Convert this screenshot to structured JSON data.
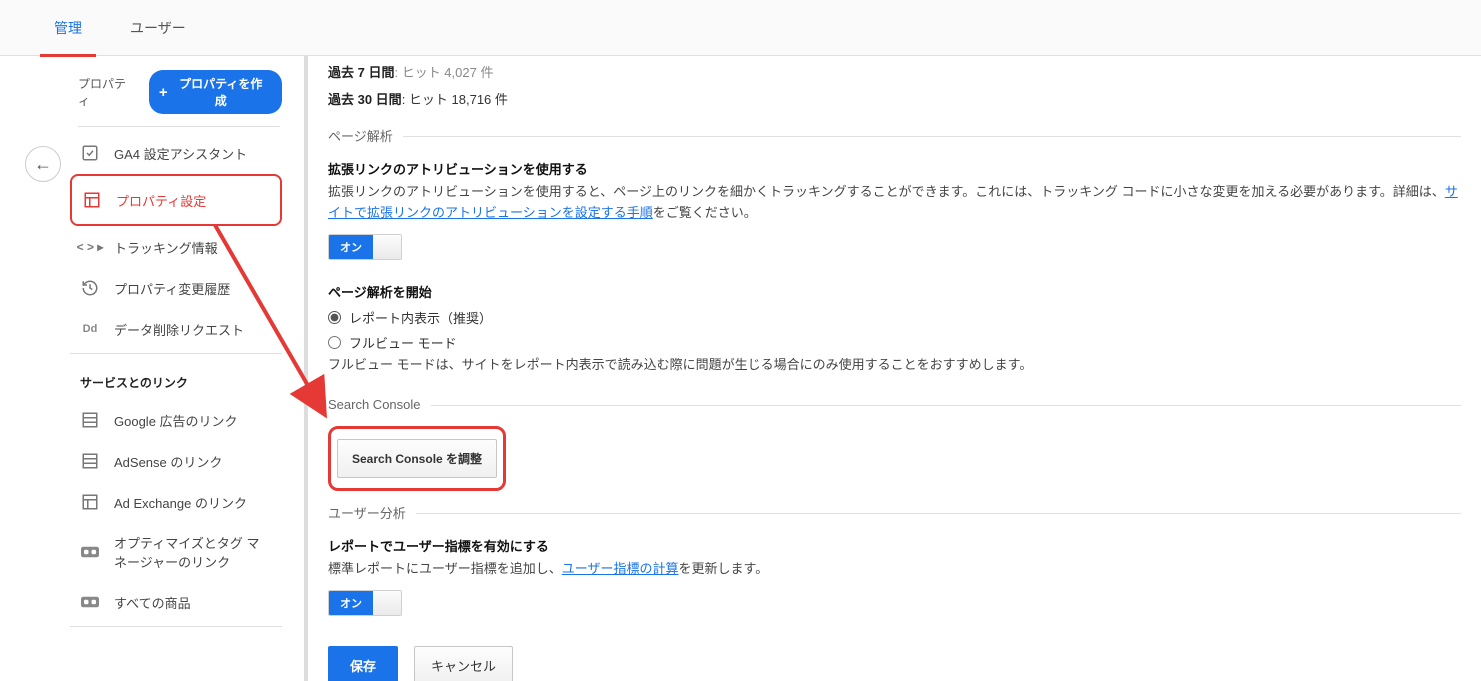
{
  "tabs": {
    "admin": "管理",
    "users": "ユーザー"
  },
  "sidebar": {
    "property_label": "プロパティ",
    "create_property": "プロパティを作成",
    "items": {
      "ga4": "GA4 設定アシスタント",
      "property_settings": "プロパティ設定",
      "tracking_info": "トラッキング情報",
      "change_history": "プロパティ変更履歴",
      "data_delete": "データ削除リクエスト"
    },
    "section_service_link": "サービスとのリンク",
    "service_items": {
      "google_ads": "Google 広告のリンク",
      "adsense": "AdSense のリンク",
      "ad_exchange": "Ad Exchange のリンク",
      "optimize": "オプティマイズとタグ マネージャーのリンク",
      "all_products": "すべての商品"
    }
  },
  "main": {
    "row7_label": "過去 7 日間",
    "row7_value": ": ヒット 4,027 件",
    "row30_label": "過去 30 日間",
    "row30_value": ": ヒット 18,716 件",
    "page_analysis_header": "ページ解析",
    "ext_link_title": "拡張リンクのアトリビューションを使用する",
    "ext_link_desc_a": "拡張リンクのアトリビューションを使用すると、ページ上のリンクを細かくトラッキングすることができます。これには、トラッキング コードに小さな変更を加える必要があります。詳細は、",
    "ext_link_link": "サイトで拡張リンクのアトリビューションを設定する手順",
    "ext_link_desc_b": "をご覧ください。",
    "on_label": "オン",
    "start_page_analysis_title": "ページ解析を開始",
    "radio1": "レポート内表示（推奨）",
    "radio2": "フルビュー モード",
    "fullview_note": "フルビュー モードは、サイトをレポート内表示で読み込む際に問題が生じる場合にのみ使用することをおすすめします。",
    "search_console_header": "Search Console",
    "sc_button": "Search Console を調整",
    "user_analysis_header": "ユーザー分析",
    "user_metrics_title": "レポートでユーザー指標を有効にする",
    "user_metrics_desc_a": "標準レポートにユーザー指標を追加し、",
    "user_metrics_link": "ユーザー指標の計算",
    "user_metrics_desc_b": "を更新します。",
    "save": "保存",
    "cancel": "キャンセル"
  }
}
